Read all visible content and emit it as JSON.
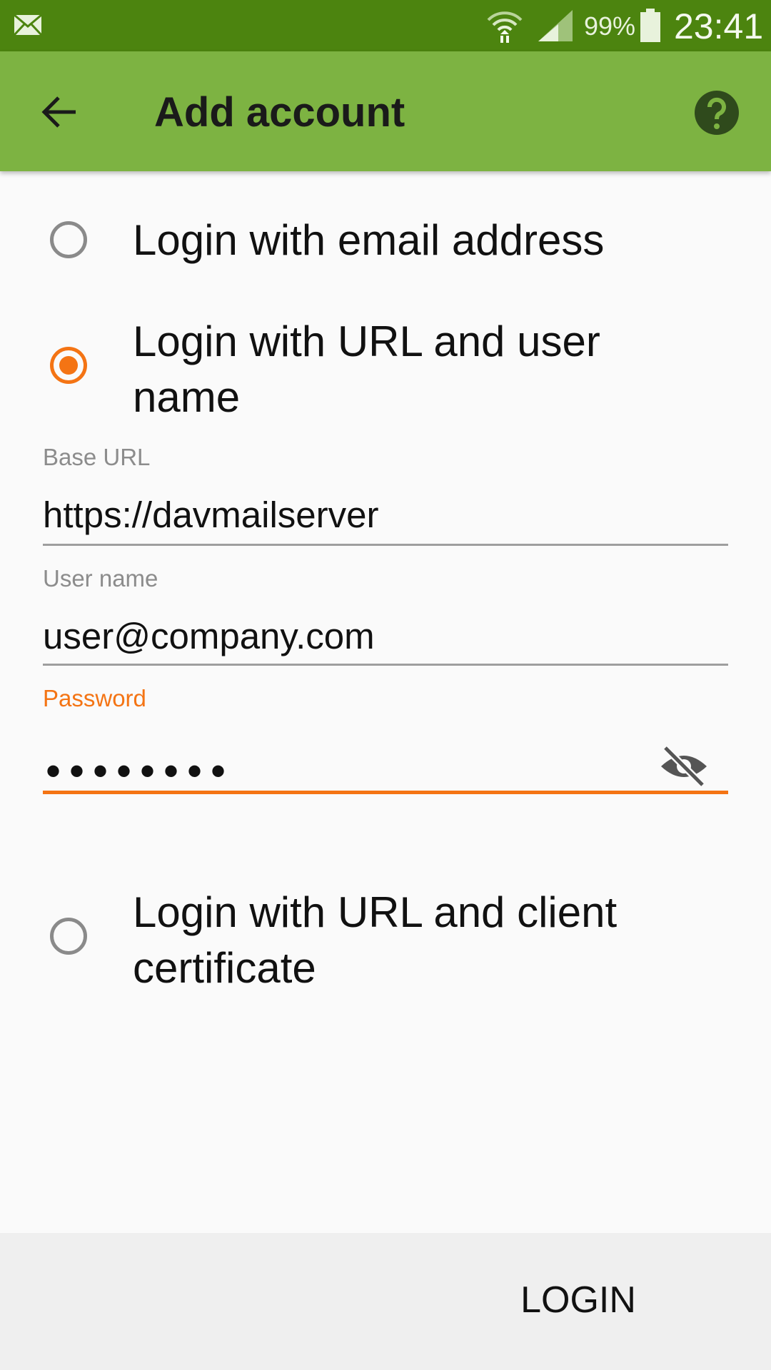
{
  "status_bar": {
    "battery_percent": "99%",
    "time": "23:41",
    "icons": [
      "mail-icon",
      "wifi-icon",
      "signal-icon",
      "battery-icon"
    ]
  },
  "app_bar": {
    "title": "Add account",
    "icons": [
      "arrow-back-icon",
      "help-icon"
    ],
    "color": "#7db342"
  },
  "options": {
    "email": {
      "label": "Login with email address",
      "selected": false
    },
    "url_user": {
      "label": "Login with URL and user name",
      "selected": true
    },
    "url_cert": {
      "label": "Login with URL and client certificate",
      "selected": false
    }
  },
  "form": {
    "base_url": {
      "label": "Base URL",
      "value": "https://davmailserver"
    },
    "user_name": {
      "label": "User name",
      "value": "user@company.com"
    },
    "password": {
      "label": "Password",
      "masked_value": "••••••••",
      "icon": "visibility-off-icon"
    }
  },
  "footer": {
    "login_label": "LOGIN"
  },
  "colors": {
    "accent": "#f47414",
    "status_bar": "#4c840f"
  }
}
